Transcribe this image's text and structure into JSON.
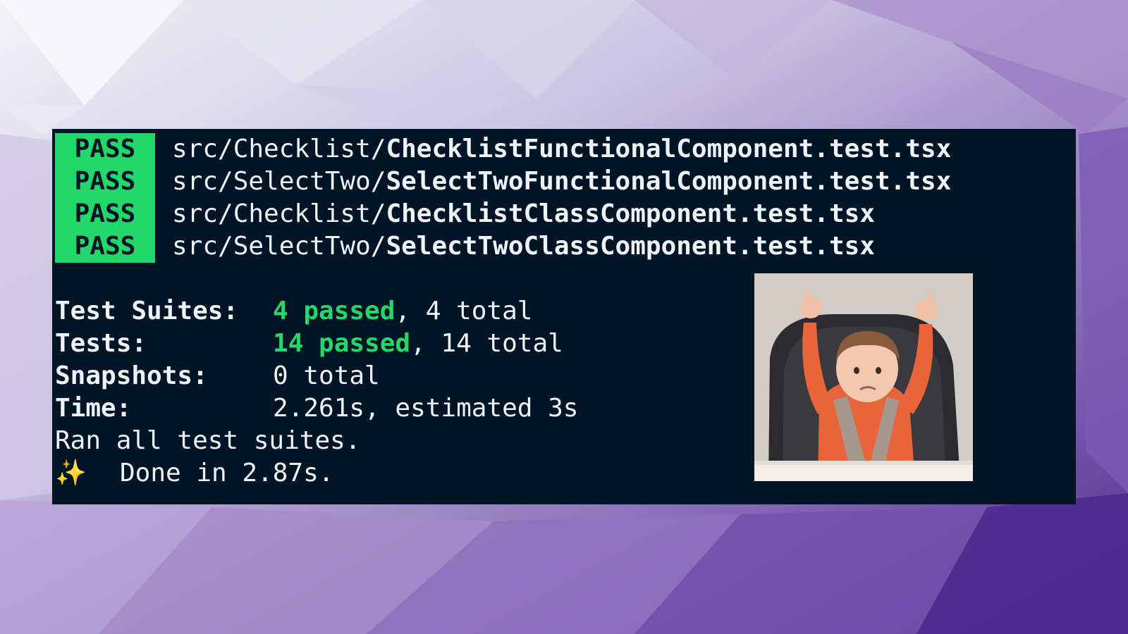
{
  "terminal": {
    "pass_rows": [
      {
        "badge": "PASS",
        "dir": "src/Checklist/",
        "file": "ChecklistFunctionalComponent.test.tsx"
      },
      {
        "badge": "PASS",
        "dir": "src/SelectTwo/",
        "file": "SelectTwoFunctionalComponent.test.tsx"
      },
      {
        "badge": "PASS",
        "dir": "src/Checklist/",
        "file": "ChecklistClassComponent.test.tsx"
      },
      {
        "badge": "PASS",
        "dir": "src/SelectTwo/",
        "file": "SelectTwoClassComponent.test.tsx"
      }
    ],
    "summary": {
      "suites_label": "Test Suites:",
      "suites_passed": "4 passed",
      "suites_total": ", 4 total",
      "tests_label": "Tests:",
      "tests_passed": "14 passed",
      "tests_total": ", 14 total",
      "snapshots_label": "Snapshots:",
      "snapshots_value": "0 total",
      "time_label": "Time:",
      "time_value": "2.261s, estimated 3s",
      "ran_all": "Ran all test suites.",
      "done_icon": "✨",
      "done_text": "Done in 2.87s."
    }
  },
  "colors": {
    "terminal_bg": "#021526",
    "pass_green": "#22d86b",
    "text": "#eef2f6"
  },
  "media": {
    "gif_icon": "celebrating-baby-image"
  }
}
